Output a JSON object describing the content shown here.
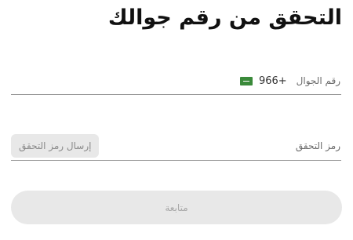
{
  "header": {
    "title": "التحقق من رقم جوالك"
  },
  "phone_field": {
    "label": "رقم الجوال",
    "dial_code": "966+",
    "flag_icon": "saudi-arabia-flag-icon",
    "value": ""
  },
  "code_field": {
    "label": "رمز التحقق",
    "value": "",
    "send_code_label": "إرسال رمز التحقق"
  },
  "actions": {
    "continue_label": "متابعة"
  },
  "colors": {
    "button_bg": "#e8e8e8",
    "button_text": "#a8a8a8",
    "flag_green": "#3a8a3a",
    "divider": "#9a9a9a"
  }
}
